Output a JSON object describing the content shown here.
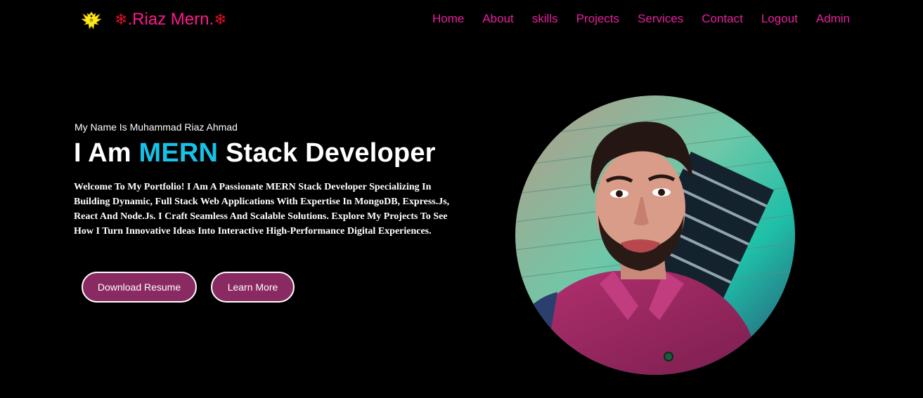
{
  "header": {
    "logo_icon": "eagle-icon",
    "brand_prefix_icon": "❄",
    "brand_text": ".Riaz Mern.",
    "brand_suffix_icon": "❄",
    "nav": [
      {
        "label": "Home"
      },
      {
        "label": "About"
      },
      {
        "label": "skills"
      },
      {
        "label": "Projects"
      },
      {
        "label": "Services"
      },
      {
        "label": "Contact"
      },
      {
        "label": "Logout"
      },
      {
        "label": "Admin"
      }
    ]
  },
  "hero": {
    "intro": "My Name Is Muhammad Riaz Ahmad",
    "headline_pre": "I Am ",
    "headline_accent": "MERN",
    "headline_post": " Stack Developer",
    "description": "Welcome To My Portfolio! I Am A Passionate MERN Stack Developer Specializing In Building Dynamic, Full Stack Web Applications With Expertise In MongoDB, Express.Js, React And Node.Js. I Craft Seamless And Scalable Solutions. Explore My Projects To See How I Turn Innovative Ideas Into Interactive High-Performance Digital Experiences.",
    "buttons": {
      "download": "Download Resume",
      "learn": "Learn More"
    },
    "portrait": "profile-photo"
  },
  "colors": {
    "background": "#000000",
    "brand": "#ff1a8c",
    "nav": "#e6209e",
    "accent": "#17c1e8",
    "button": "#8a2a62"
  }
}
